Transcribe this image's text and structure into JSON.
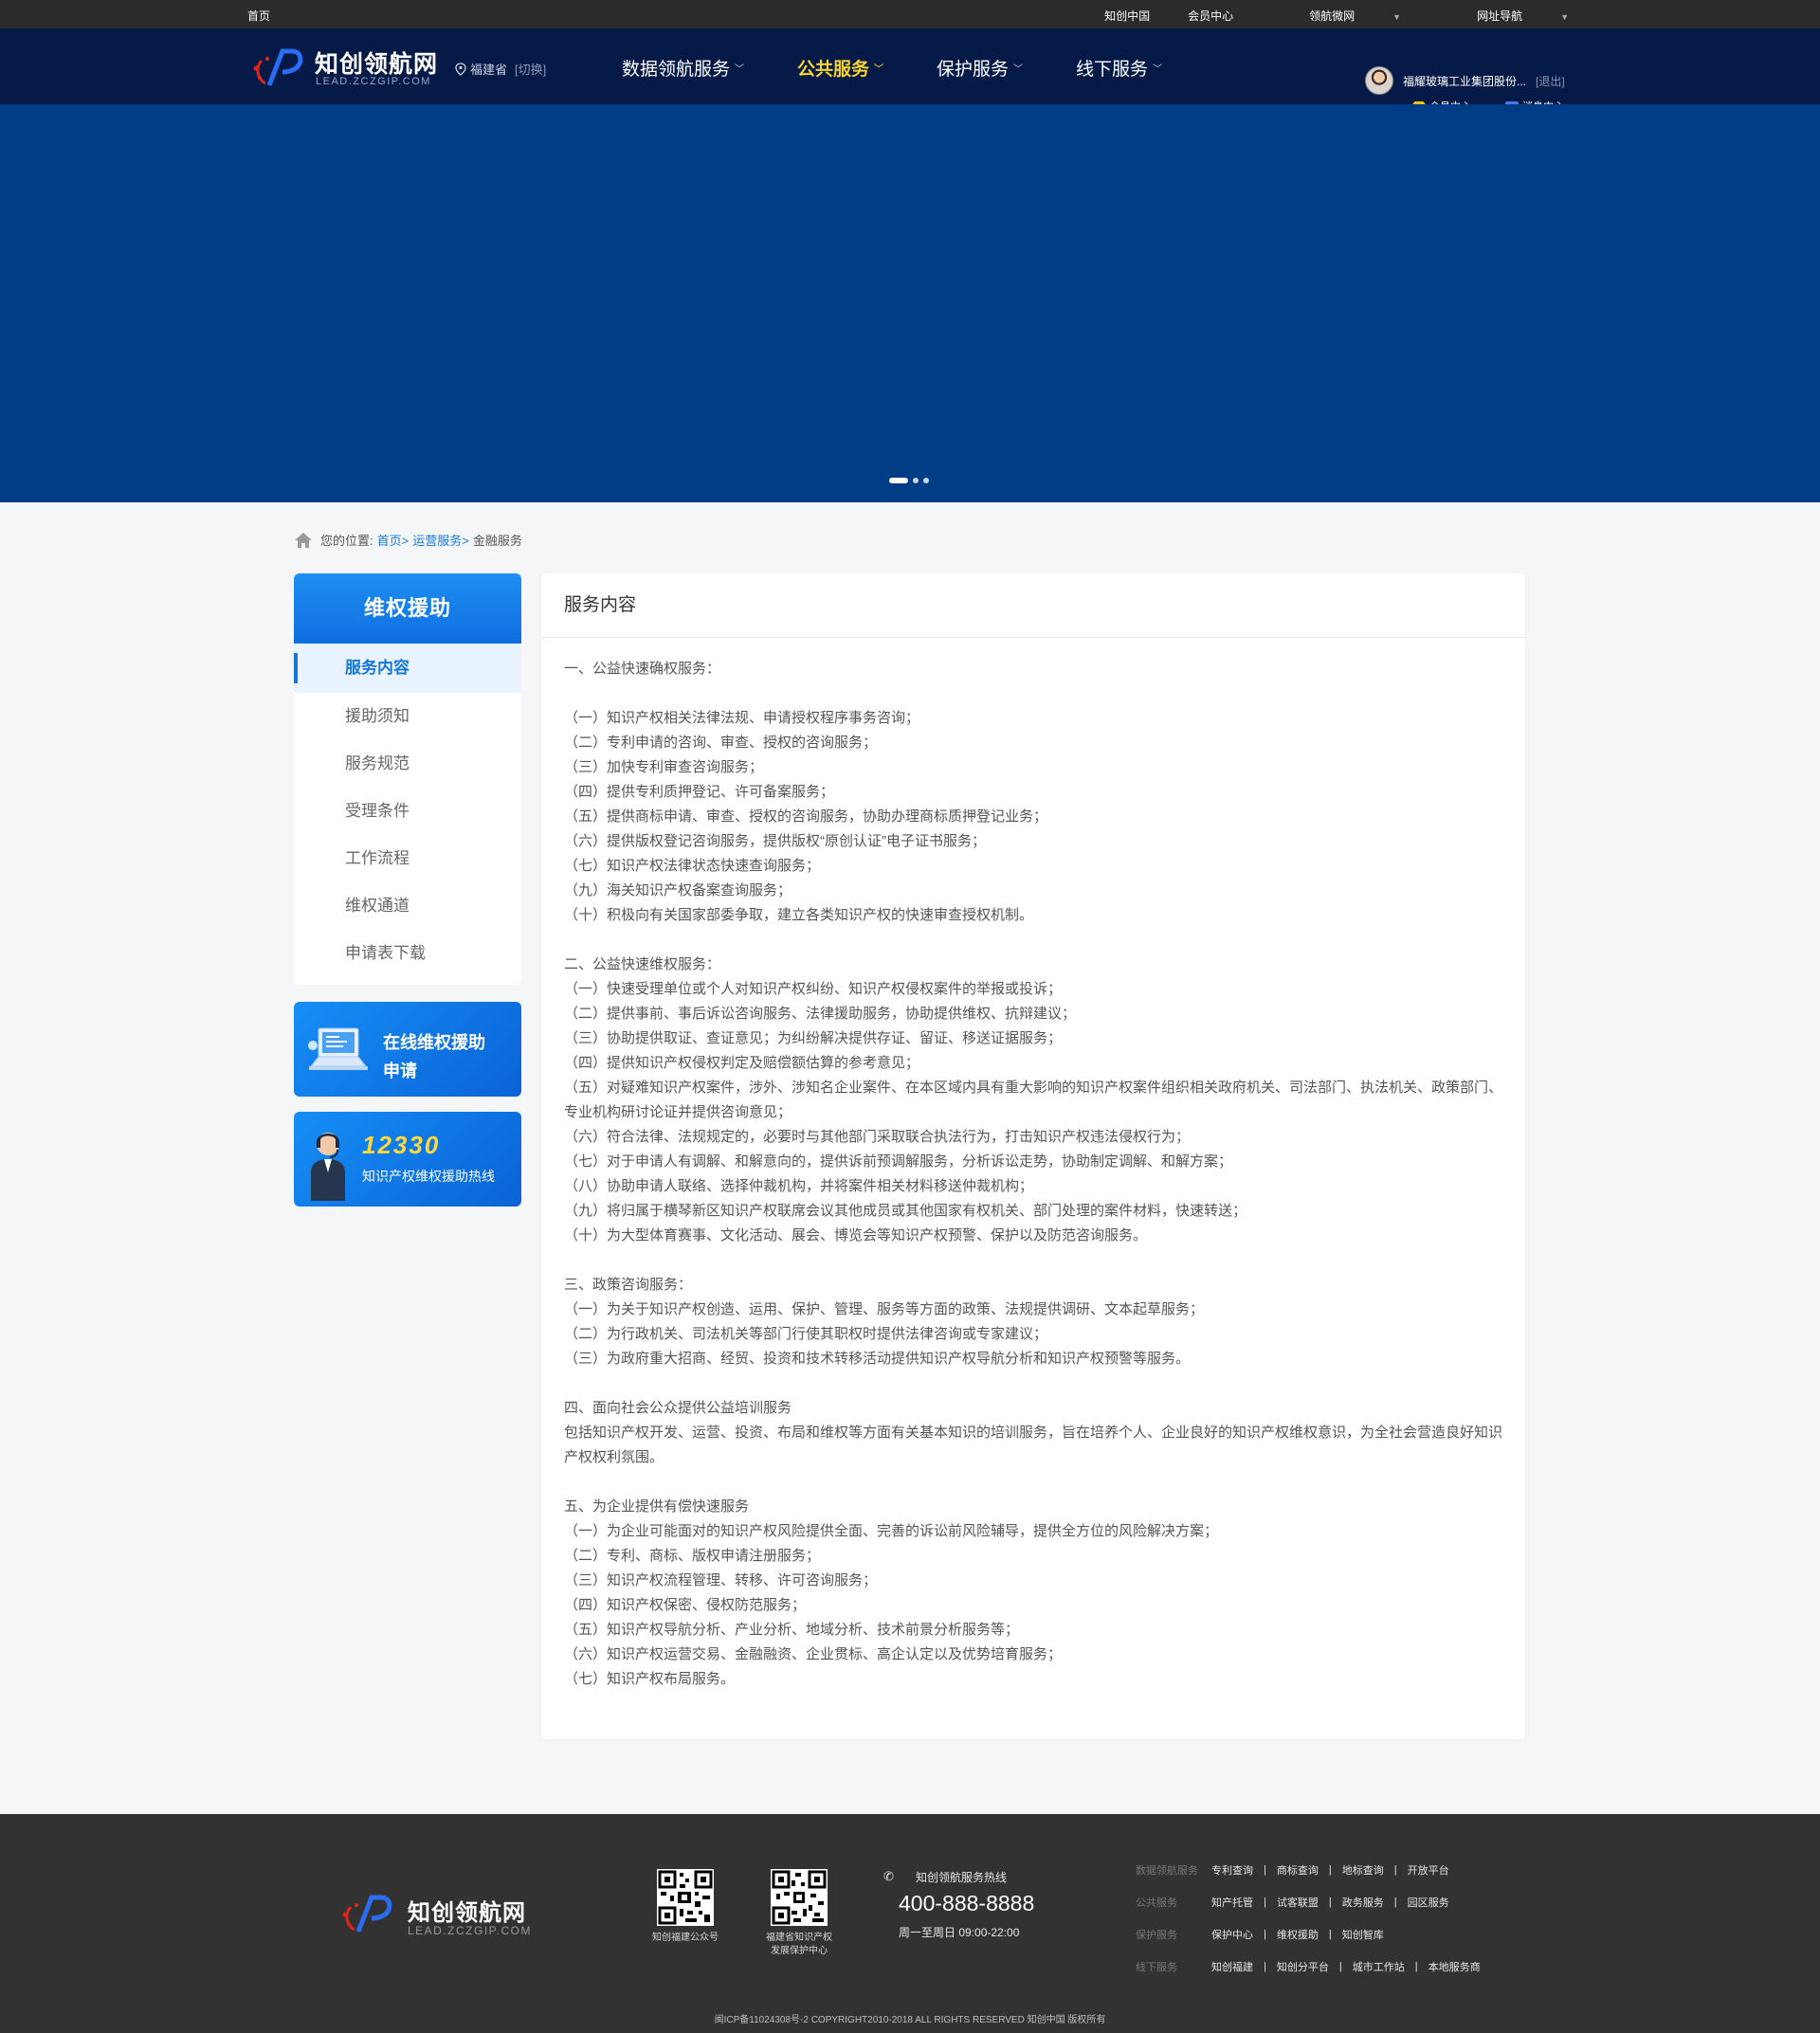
{
  "topbar": {
    "home": "首页",
    "links": [
      "知创中国",
      "会员中心",
      "领航微网",
      "网址导航"
    ]
  },
  "header": {
    "logo_name": "知创领航网",
    "logo_sub": "LEAD.ZCZGIP.COM",
    "location": "福建省",
    "switch": "[切换]",
    "nav": [
      "数据领航服务",
      "公共服务",
      "保护服务",
      "线下服务"
    ],
    "active_nav_index": 1,
    "user_name": "福耀玻璃工业集团股份...",
    "logout": "[退出]",
    "member_center": "会员中心",
    "message_center": "消息中心"
  },
  "breadcrumb": {
    "prefix": "您的位置:",
    "home": "首页>",
    "parent": "运营服务>",
    "current": "金融服务"
  },
  "sidebar": {
    "title": "维权援助",
    "items": [
      "服务内容",
      "援助须知",
      "服务规范",
      "受理条件",
      "工作流程",
      "维权通道",
      "申请表下载"
    ],
    "active_index": 0,
    "card1": {
      "line1": "在线维权援助",
      "line2": "申请"
    },
    "card2": {
      "number": "12330",
      "label": "知识产权维权援助热线"
    }
  },
  "content": {
    "title": "服务内容",
    "body": "一、公益快速确权服务：\n\n（一）知识产权相关法律法规、申请授权程序事务咨询；\n（二）专利申请的咨询、审查、授权的咨询服务；\n（三）加快专利审查咨询服务；\n（四）提供专利质押登记、许可备案服务；\n（五）提供商标申请、审查、授权的咨询服务，协助办理商标质押登记业务；\n（六）提供版权登记咨询服务，提供版权“原创认证”电子证书服务；\n（七）知识产权法律状态快速查询服务；\n（九）海关知识产权备案查询服务；\n（十）积极向有关国家部委争取，建立各类知识产权的快速审查授权机制。\n\n二、公益快速维权服务：\n（一）快速受理单位或个人对知识产权纠纷、知识产权侵权案件的举报或投诉；\n（二）提供事前、事后诉讼咨询服务、法律援助服务，协助提供维权、抗辩建议；\n（三）协助提供取证、查证意见；为纠纷解决提供存证、留证、移送证据服务；\n（四）提供知识产权侵权判定及赔偿额估算的参考意见；\n（五）对疑难知识产权案件，涉外、涉知名企业案件、在本区域内具有重大影响的知识产权案件组织相关政府机关、司法部门、执法机关、政策部门、专业机构研讨论证并提供咨询意见；\n（六）符合法律、法规规定的，必要时与其他部门采取联合执法行为，打击知识产权违法侵权行为；\n（七）对于申请人有调解、和解意向的，提供诉前预调解服务，分析诉讼走势，协助制定调解、和解方案；\n（八）协助申请人联络、选择仲裁机构，并将案件相关材料移送仲裁机构；\n（九）将归属于横琴新区知识产权联席会议其他成员或其他国家有权机关、部门处理的案件材料，快速转送；\n（十）为大型体育赛事、文化活动、展会、博览会等知识产权预警、保护以及防范咨询服务。\n\n三、政策咨询服务：\n（一）为关于知识产权创造、运用、保护、管理、服务等方面的政策、法规提供调研、文本起草服务；\n（二）为行政机关、司法机关等部门行使其职权时提供法律咨询或专家建议；\n（三）为政府重大招商、经贸、投资和技术转移活动提供知识产权导航分析和知识产权预警等服务。\n\n四、面向社会公众提供公益培训服务\n包括知识产权开发、运营、投资、布局和维权等方面有关基本知识的培训服务，旨在培养个人、企业良好的知识产权维权意识，为全社会营造良好知识产权权利氛围。\n\n五、为企业提供有偿快速服务\n（一）为企业可能面对的知识产权风险提供全面、完善的诉讼前风险辅导，提供全方位的风险解决方案；\n（二）专利、商标、版权申请注册服务；\n（三）知识产权流程管理、转移、许可咨询服务；\n（四）知识产权保密、侵权防范服务；\n（五）知识产权导航分析、产业分析、地域分析、技术前景分析服务等；\n（六）知识产权运营交易、金融融资、企业贯标、高企认定以及优势培育服务；\n（七）知识产权布局服务。"
  },
  "footer": {
    "logo_name": "知创领航网",
    "logo_sub": "LEAD.ZCZGIP.COM",
    "qr1_label": "知创福建公众号",
    "qr2_label_1": "福建省知识产权",
    "qr2_label_2": "发展保护中心",
    "hotline_label": "知创领航服务热线",
    "hotline_number": "400-888-8888",
    "hotline_time": "周一至周日 09:00-22:00",
    "link_rows": [
      {
        "cat": "数据领航服务",
        "links": [
          "专利查询",
          "商标查询",
          "地标查询",
          "开放平台"
        ]
      },
      {
        "cat": "公共服务",
        "links": [
          "知产托管",
          "试客联盟",
          "政务服务",
          "园区服务"
        ]
      },
      {
        "cat": "保护服务",
        "links": [
          "保护中心",
          "维权援助",
          "知创智库"
        ]
      },
      {
        "cat": "线下服务",
        "links": [
          "知创福建",
          "知创分平台",
          "城市工作站",
          "本地服务商"
        ]
      }
    ],
    "copyright": "闽ICP备11024308号-2 COPYRIGHT2010-2018 ALL RIGHTS RESERVED 知创中国 版权所有"
  },
  "colors": {
    "topbar": "#2b2b2b",
    "header": "#061a47",
    "banner": "#003d86",
    "accent": "#1677d8",
    "nav_active": "#f6d232",
    "footer": "#323232"
  }
}
